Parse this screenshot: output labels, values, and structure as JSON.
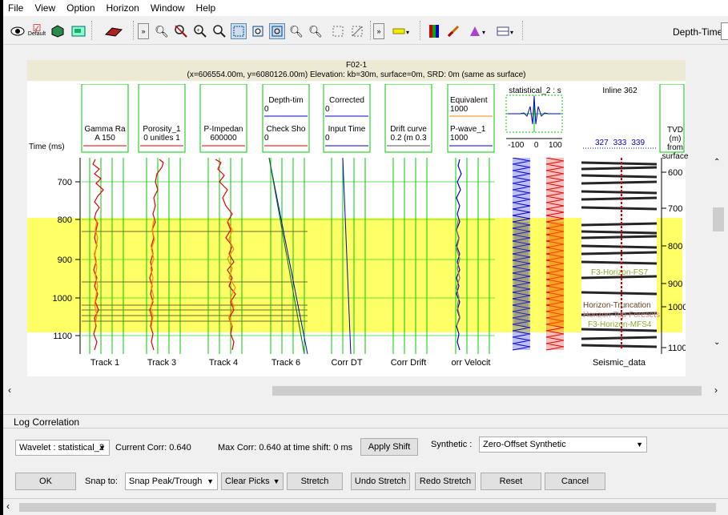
{
  "menu": [
    "File",
    "View",
    "Option",
    "Horizon",
    "Window",
    "Help"
  ],
  "toolbar": {
    "default_label": "Default",
    "depth_time_label": "Depth-Time:"
  },
  "well": {
    "name": "F02-1",
    "coords": "(x=606554.00m, y=6080126.00m) Elevation: kb=30m, surface=0m, SRD: 0m (same as surface)"
  },
  "columns": {
    "time_label": "Time (ms)",
    "gamma": {
      "name": "Gamma Ra",
      "range": "A  150"
    },
    "porosity": {
      "name": "Porosity_1",
      "range": "0  unitles  1"
    },
    "pimp": {
      "name": "P-Impedan",
      "range": "600000"
    },
    "depth": {
      "top": "Depth-tim",
      "top_val": "0",
      "name": "Check Sho",
      "range": "0"
    },
    "corrected": {
      "top": "Corrected",
      "top_val": "0",
      "name": "Input Time",
      "range": "0"
    },
    "drift": {
      "name": "Drift curve",
      "range": "0.2  (m  0.3"
    },
    "equiv": {
      "top": "Equivalent",
      "top_val": "1000",
      "name": "P-wave_1",
      "range": "1000"
    },
    "wavelet": {
      "name": "statistical_2 : s",
      "ticks": [
        "-100",
        "0",
        "100"
      ]
    },
    "inline": {
      "name": "Inline 362",
      "traces": [
        "327",
        "333",
        "339"
      ]
    },
    "tvd": {
      "label": "TVD (m) from surface"
    }
  },
  "time_ticks": [
    "700",
    "800",
    "900",
    "1000",
    "1100"
  ],
  "tvd_ticks": [
    "600",
    "700",
    "800",
    "900",
    "1000",
    "1100"
  ],
  "horizons": [
    "F3-Horizon-FS7",
    "Horizon-Truncation",
    "Horizon-Top-Foresets",
    "F3-Horizon-MFS4"
  ],
  "track_labels": [
    "Track 1",
    "Track 3",
    "Track 4",
    "Track 6",
    "Corr DT",
    "Corr Drift",
    "orr Velocit",
    "Seismic_data"
  ],
  "log_correlation": {
    "title": "Log Correlation",
    "wavelet_select": "Wavelet : statistical_2",
    "current_corr": "Current Corr:  0.640",
    "max_corr": "Max Corr:  0.640 at time shift: 0 ms",
    "apply_shift": "Apply Shift",
    "synthetic_label": "Synthetic :",
    "synthetic_select": "Zero-Offset Synthetic",
    "ok": "OK",
    "snap_label": "Snap to:",
    "snap_select": "Snap Peak/Trough",
    "clear_picks": "Clear Picks",
    "stretch": "Stretch",
    "undo_stretch": "Undo Stretch",
    "redo_stretch": "Redo Stretch",
    "reset": "Reset",
    "cancel": "Cancel"
  },
  "colors": {
    "highlight": "#ffff66",
    "track_green": "#00cc00",
    "log_red": "#e00000",
    "log_orange": "#ff8800",
    "blue": "#0000cc"
  }
}
